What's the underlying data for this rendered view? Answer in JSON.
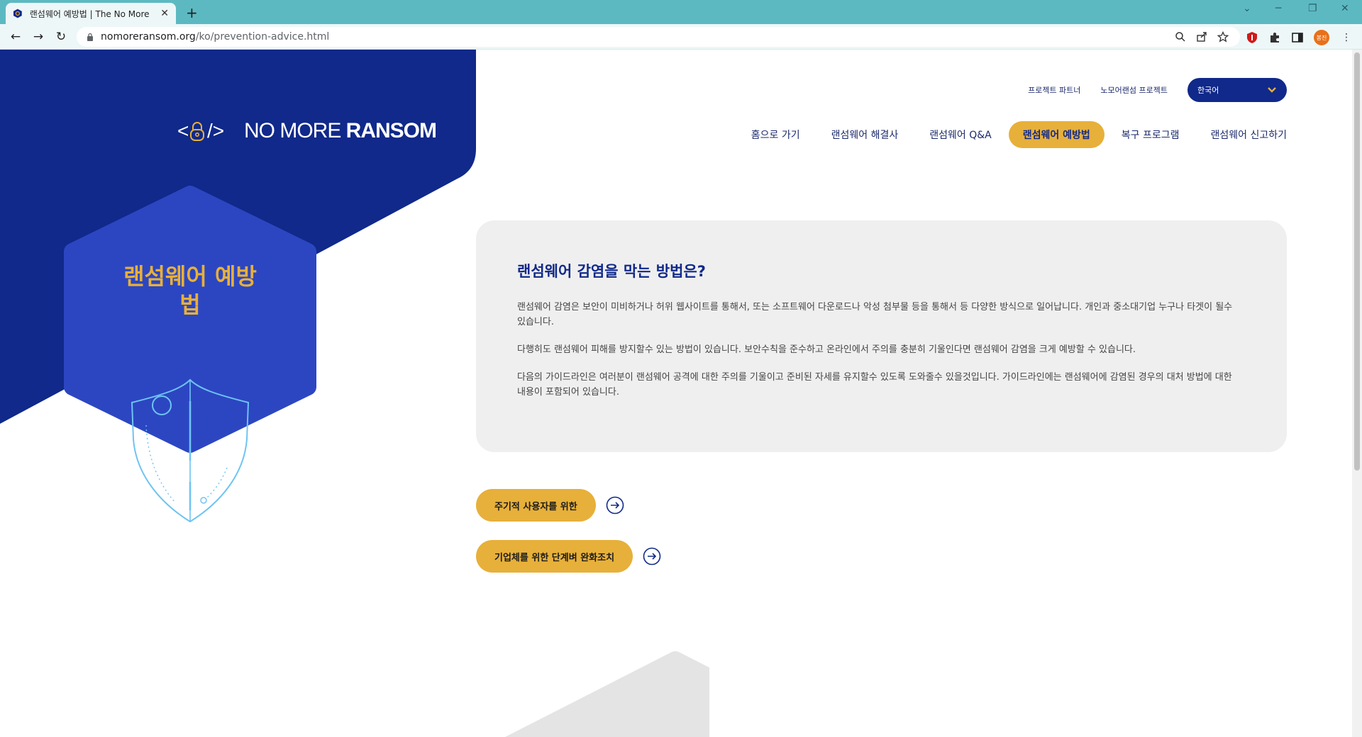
{
  "browser": {
    "tab_title": "랜섬웨어 예방법 | The No More",
    "tab_close": "✕",
    "new_tab": "+",
    "url_host": "nomoreransom.org",
    "url_path": "/ko/prevention-advice.html",
    "profile_label": "봉진",
    "window_controls": [
      "⌄",
      "─",
      "❐",
      "✕"
    ]
  },
  "header": {
    "logo_brackets": "</>",
    "logo_text_light": "NO MORE ",
    "logo_text_bold": "RANSOM",
    "top_links": [
      "프로젝트 파트너",
      "노모어랜섬 프로젝트"
    ],
    "language": "한국어",
    "nav": [
      {
        "label": "홈으로 가기",
        "active": false
      },
      {
        "label": "랜섬웨어 해결사",
        "active": false
      },
      {
        "label": "랜섬웨어 Q&A",
        "active": false
      },
      {
        "label": "랜섬웨어 예방법",
        "active": true
      },
      {
        "label": "복구 프로그램",
        "active": false
      },
      {
        "label": "랜섬웨어 신고하기",
        "active": false
      }
    ]
  },
  "hero": {
    "title_line1": "랜섬웨어 예방",
    "title_line2": "법"
  },
  "card": {
    "heading": "랜섬웨어 감염을 막는 방법은?",
    "paragraphs": [
      "랜섬웨어 감염은 보안이 미비하거나 허위 웹사이트를 통해서, 또는 소프트웨어 다운로드나 악성 첨부물 등을 통해서 등 다양한 방식으로 일어납니다. 개인과 중소대기업 누구나 타겟이 될수 있습니다.",
      "다행히도 랜섬웨어 피해를 방지할수 있는 방법이 있습니다. 보안수칙을 준수하고 온라인에서 주의를 충분히 기울인다면 랜섬웨어 감염을 크게 예방할 수 있습니다.",
      "다음의 가이드라인은 여러분이 랜섬웨어 공격에 대한 주의를 기울이고 준비된 자세를 유지할수 있도록 도와줄수 있을것입니다. 가이드라인에는 랜섬웨어에 감염된 경우의 대처 방법에 대한 내용이 포함되어 있습니다."
    ]
  },
  "ctas": [
    {
      "label": "주기적 사용자를 위한"
    },
    {
      "label": "기업체를 위한 단계벼 완화조치"
    }
  ],
  "colors": {
    "navy": "#10298a",
    "royal": "#2c46c2",
    "gold": "#e7b03a",
    "browser_teal": "#5cb9c2"
  }
}
